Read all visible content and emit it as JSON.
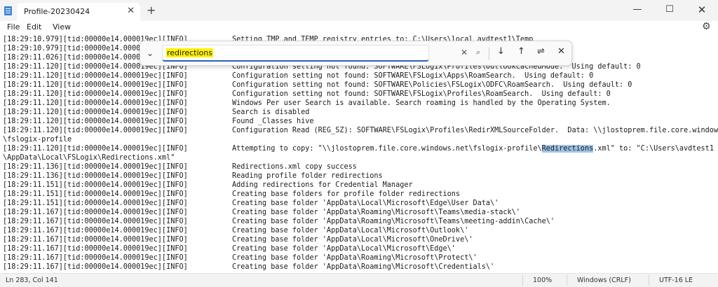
{
  "window": {
    "tab_title": "Profile-20230424",
    "tab_close": "✕",
    "new_tab": "+",
    "minimize": "—",
    "maximize": "☐",
    "close": "✕"
  },
  "menu": {
    "file": "File",
    "edit": "Edit",
    "view": "View"
  },
  "icons": {
    "settings": "⚙",
    "expand": "⌄",
    "clear": "✕",
    "search": "⌕",
    "down": "↓",
    "up": "↑",
    "options": "⇌",
    "close": "✕"
  },
  "find": {
    "query": "redirections"
  },
  "lines": [
    {
      "p": "[18:29:10.979][tid:00000e14.000019ec][INFO]",
      "m": "Setting TMP and TEMP registry entries to: C:\\Users\\local_avdtest1\\Temp"
    },
    {
      "p": "[18:29:10.979][tid:00000e14.00001",
      "m": ""
    },
    {
      "p": "[18:29:11.026][tid:00000e14.00001",
      "m": ""
    },
    {
      "p": "[18:29:11.120][tid:00000e14.000019ec][INFO]",
      "m": "Configuration setting not found: SOFTWARE\\FSLogix\\Profiles\\OutlookCachedMode.  Using default: 0"
    },
    {
      "p": "[18:29:11.120][tid:00000e14.000019ec][INFO]",
      "m": "Configuration setting not found: SOFTWARE\\FSLogix\\Apps\\RoamSearch.  Using default: 0"
    },
    {
      "p": "[18:29:11.120][tid:00000e14.000019ec][INFO]",
      "m": "Configuration setting not found: SOFTWARE\\Policies\\FSLogix\\ODFC\\RoamSearch.  Using default: 0"
    },
    {
      "p": "[18:29:11.120][tid:00000e14.000019ec][INFO]",
      "m": "Configuration setting not found: SOFTWARE\\FSLogix\\Profiles\\RoamSearch.  Using default: 0"
    },
    {
      "p": "[18:29:11.120][tid:00000e14.000019ec][INFO]",
      "m": "Windows Per user Search is available. Search roaming is handled by the Operating System."
    },
    {
      "p": "[18:29:11.120][tid:00000e14.000019ec][INFO]",
      "m": "Search is disabled"
    },
    {
      "p": "[18:29:11.120][tid:00000e14.000019ec][INFO]",
      "m": "Found _Classes hive"
    },
    {
      "p": "[18:29:11.120][tid:00000e14.000019ec][INFO]",
      "m": "Configuration Read (REG_SZ): SOFTWARE\\FSLogix\\Profiles\\RedirXMLSourceFolder.  Data: \\\\jlostoprem.file.core.windows.net"
    },
    {
      "p": "\\fslogix-profile",
      "m": ""
    },
    {
      "p": "[18:29:11.120][tid:00000e14.000019ec][INFO]",
      "m": "Attempting to copy: \"\\\\jlostoprem.file.core.windows.net\\fslogix-profile\\",
      "hl": "Redirections",
      "m2": ".xml\" to: \"C:\\Users\\avdtest1"
    },
    {
      "p": "\\AppData\\Local\\FSLogix\\Redirections.xml\"",
      "m": ""
    },
    {
      "p": "[18:29:11.136][tid:00000e14.000019ec][INFO]",
      "m": "Redirections.xml copy success"
    },
    {
      "p": "[18:29:11.136][tid:00000e14.000019ec][INFO]",
      "m": "Reading profile folder redirections"
    },
    {
      "p": "[18:29:11.151][tid:00000e14.000019ec][INFO]",
      "m": "Adding redirections for Credential Manager"
    },
    {
      "p": "[18:29:11.151][tid:00000e14.000019ec][INFO]",
      "m": "Creating base folders for profile folder redirections"
    },
    {
      "p": "[18:29:11.151][tid:00000e14.000019ec][INFO]",
      "m": "Creating base folder 'AppData\\Local\\Microsoft\\Edge\\User Data\\'"
    },
    {
      "p": "[18:29:11.167][tid:00000e14.000019ec][INFO]",
      "m": "Creating base folder 'AppData\\Roaming\\Microsoft\\Teams\\media-stack\\'"
    },
    {
      "p": "[18:29:11.167][tid:00000e14.000019ec][INFO]",
      "m": "Creating base folder 'AppData\\Roaming\\Microsoft\\Teams\\meeting-addin\\Cache\\'"
    },
    {
      "p": "[18:29:11.167][tid:00000e14.000019ec][INFO]",
      "m": "Creating base folder 'AppData\\Local\\Microsoft\\Outlook\\'"
    },
    {
      "p": "[18:29:11.167][tid:00000e14.000019ec][INFO]",
      "m": "Creating base folder 'AppData\\Local\\Microsoft\\OneDrive\\'"
    },
    {
      "p": "[18:29:11.167][tid:00000e14.000019ec][INFO]",
      "m": "Creating base folder 'AppData\\Local\\Microsoft\\Edge\\'"
    },
    {
      "p": "[18:29:11.167][tid:00000e14.000019ec][INFO]",
      "m": "Creating base folder 'AppData\\Roaming\\Microsoft\\Protect\\'"
    },
    {
      "p": "[18:29:11.167][tid:00000e14.000019ec][INFO]",
      "m": "Creating base folder 'AppData\\Roaming\\Microsoft\\Credentials\\'"
    }
  ],
  "status": {
    "position": "Ln 283, Col 141",
    "zoom": "100%",
    "line_ending": "Windows (CRLF)",
    "encoding": "UTF-16 LE"
  },
  "colors": {
    "accent": "#2b63b7",
    "match_highlight": "#9fc3e7",
    "query_highlight": "#fff200"
  }
}
